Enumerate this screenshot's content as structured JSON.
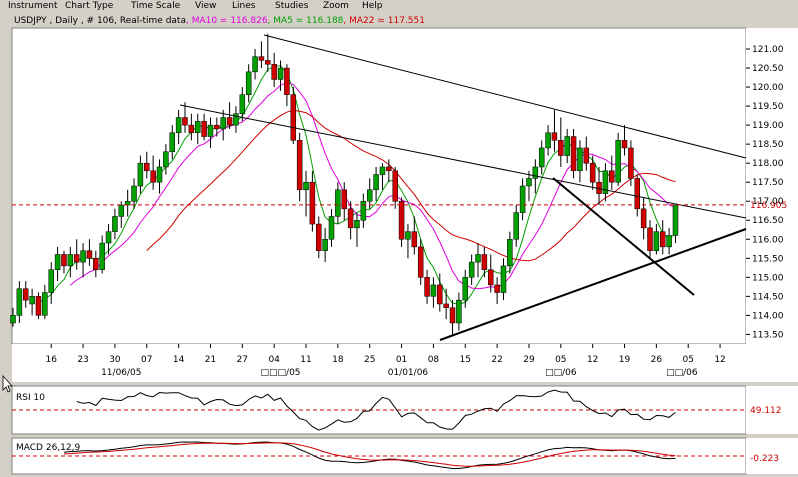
{
  "menu": [
    "Instrument",
    "Chart Type",
    "Time Scale",
    "View",
    "Lines",
    "Studies",
    "Zoom",
    "Help"
  ],
  "colors": {
    "candle_up": "#00a000",
    "candle_down": "#d00000",
    "ma10": "#e000e0",
    "ma5": "#00a000",
    "ma22": "#d00000",
    "ref_line": "#d00000",
    "trend": "#000000"
  },
  "chart_data": {
    "type": "candlestick",
    "header": {
      "symbol": "USDJPY , Daily , # 106, Real-time data",
      "ma10": ", MA10 = 116.826",
      "ma5": ", MA5 = 116.188",
      "ma22": ", MA22 = 117.551"
    },
    "ylim": [
      113.3,
      121.5
    ],
    "y_ticks": [
      113.5,
      114.0,
      114.5,
      115.0,
      115.5,
      116.0,
      116.5,
      117.0,
      117.5,
      118.0,
      118.5,
      119.0,
      119.5,
      120.0,
      120.5,
      121.0
    ],
    "y_tick_labels": [
      "113.50",
      "114.00",
      "114.50",
      "115.00",
      "115.50",
      "116.00",
      "116.50",
      "117.00",
      "117.50",
      "118.00",
      "118.50",
      "119.00",
      "119.50",
      "120.00",
      "120.50",
      "121.00"
    ],
    "last_price": {
      "value": 116.905,
      "label": "116.905"
    },
    "x_ticks": [
      {
        "i": 6,
        "label": "16"
      },
      {
        "i": 11,
        "label": "23"
      },
      {
        "i": 16,
        "label": "30"
      },
      {
        "i": 21,
        "label": "07"
      },
      {
        "i": 26,
        "label": "14"
      },
      {
        "i": 31,
        "label": "21"
      },
      {
        "i": 36,
        "label": "27"
      },
      {
        "i": 41,
        "label": "04"
      },
      {
        "i": 46,
        "label": "11"
      },
      {
        "i": 51,
        "label": "18"
      },
      {
        "i": 56,
        "label": "25"
      },
      {
        "i": 61,
        "label": "01"
      },
      {
        "i": 66,
        "label": "08"
      },
      {
        "i": 71,
        "label": "15"
      },
      {
        "i": 76,
        "label": "22"
      },
      {
        "i": 81,
        "label": "29"
      },
      {
        "i": 86,
        "label": "05"
      },
      {
        "i": 91,
        "label": "12"
      },
      {
        "i": 96,
        "label": "19"
      },
      {
        "i": 101,
        "label": "26"
      },
      {
        "i": 106,
        "label": "05"
      },
      {
        "i": 111,
        "label": "12"
      }
    ],
    "x_month_labels": [
      {
        "i": 17,
        "label": "11/06/05"
      },
      {
        "i": 42,
        "label": "□□□/05"
      },
      {
        "i": 62,
        "label": "01/01/06"
      },
      {
        "i": 86,
        "label": "□□/06"
      },
      {
        "i": 105,
        "label": "□□/06"
      }
    ],
    "candles": [
      [
        113.8,
        114.2,
        113.7,
        114.0
      ],
      [
        114.0,
        114.9,
        113.8,
        114.7
      ],
      [
        114.7,
        114.9,
        114.2,
        114.4
      ],
      [
        114.3,
        114.7,
        114.0,
        114.5
      ],
      [
        114.5,
        114.6,
        113.9,
        114.0
      ],
      [
        114.0,
        114.8,
        113.9,
        114.6
      ],
      [
        114.6,
        115.4,
        114.3,
        115.2
      ],
      [
        115.2,
        115.8,
        114.9,
        115.6
      ],
      [
        115.6,
        115.7,
        115.1,
        115.3
      ],
      [
        115.3,
        115.8,
        115.0,
        115.6
      ],
      [
        115.6,
        116.0,
        115.2,
        115.4
      ],
      [
        115.4,
        115.9,
        115.0,
        115.7
      ],
      [
        115.7,
        116.0,
        115.3,
        115.5
      ],
      [
        115.5,
        115.7,
        115.0,
        115.2
      ],
      [
        115.2,
        116.1,
        115.1,
        115.9
      ],
      [
        115.9,
        116.4,
        115.6,
        116.2
      ],
      [
        116.2,
        116.8,
        116.0,
        116.6
      ],
      [
        116.6,
        117.0,
        116.3,
        116.9
      ],
      [
        116.9,
        117.3,
        116.6,
        117.0
      ],
      [
        117.0,
        117.6,
        116.8,
        117.4
      ],
      [
        117.4,
        118.2,
        117.2,
        118.0
      ],
      [
        118.0,
        118.3,
        117.6,
        117.8
      ],
      [
        117.8,
        118.2,
        117.3,
        117.5
      ],
      [
        117.5,
        118.1,
        117.2,
        117.9
      ],
      [
        117.9,
        118.5,
        117.7,
        118.3
      ],
      [
        118.3,
        119.0,
        118.1,
        118.8
      ],
      [
        118.8,
        119.4,
        118.5,
        119.2
      ],
      [
        119.2,
        119.6,
        118.8,
        119.0
      ],
      [
        119.0,
        119.3,
        118.6,
        118.8
      ],
      [
        118.8,
        119.3,
        118.5,
        119.1
      ],
      [
        119.1,
        119.3,
        118.6,
        118.7
      ],
      [
        118.7,
        119.2,
        118.4,
        119.0
      ],
      [
        119.0,
        119.2,
        118.7,
        118.9
      ],
      [
        118.9,
        119.4,
        118.6,
        119.2
      ],
      [
        119.2,
        119.6,
        118.9,
        119.0
      ],
      [
        119.0,
        119.5,
        118.8,
        119.3
      ],
      [
        119.3,
        120.0,
        119.1,
        119.8
      ],
      [
        119.8,
        120.6,
        119.6,
        120.4
      ],
      [
        120.4,
        121.0,
        120.2,
        120.8
      ],
      [
        120.8,
        121.2,
        120.5,
        120.7
      ],
      [
        120.7,
        121.4,
        120.4,
        120.6
      ],
      [
        120.6,
        120.9,
        120.0,
        120.2
      ],
      [
        120.2,
        120.7,
        119.9,
        120.5
      ],
      [
        120.5,
        120.6,
        119.5,
        119.8
      ],
      [
        119.8,
        120.0,
        118.5,
        118.6
      ],
      [
        118.6,
        118.8,
        117.0,
        117.3
      ],
      [
        117.3,
        117.8,
        116.6,
        117.5
      ],
      [
        117.5,
        117.8,
        116.2,
        116.4
      ],
      [
        116.4,
        116.6,
        115.5,
        115.7
      ],
      [
        115.7,
        116.3,
        115.4,
        116.0
      ],
      [
        116.0,
        116.8,
        115.8,
        116.6
      ],
      [
        116.6,
        117.5,
        116.4,
        117.3
      ],
      [
        117.3,
        117.5,
        116.5,
        116.8
      ],
      [
        116.8,
        117.0,
        116.0,
        116.3
      ],
      [
        116.3,
        116.7,
        115.8,
        116.5
      ],
      [
        116.5,
        117.2,
        116.3,
        117.0
      ],
      [
        117.0,
        117.6,
        116.8,
        117.3
      ],
      [
        117.3,
        117.9,
        117.0,
        117.7
      ],
      [
        117.7,
        118.0,
        117.3,
        117.9
      ],
      [
        117.9,
        118.1,
        117.5,
        117.8
      ],
      [
        117.8,
        117.9,
        116.8,
        117.0
      ],
      [
        117.0,
        117.1,
        115.8,
        116.0
      ],
      [
        116.0,
        116.4,
        115.5,
        116.2
      ],
      [
        116.2,
        116.6,
        115.6,
        115.8
      ],
      [
        115.8,
        116.0,
        114.8,
        115.0
      ],
      [
        115.0,
        115.2,
        114.3,
        114.5
      ],
      [
        114.5,
        115.0,
        114.2,
        114.8
      ],
      [
        114.8,
        115.1,
        114.1,
        114.3
      ],
      [
        114.3,
        114.7,
        113.9,
        114.2
      ],
      [
        114.2,
        114.4,
        113.5,
        113.8
      ],
      [
        113.8,
        114.6,
        113.6,
        114.4
      ],
      [
        114.4,
        115.2,
        114.2,
        115.0
      ],
      [
        115.0,
        115.6,
        114.8,
        115.4
      ],
      [
        115.4,
        115.9,
        115.0,
        115.6
      ],
      [
        115.6,
        115.8,
        115.0,
        115.2
      ],
      [
        115.2,
        115.6,
        114.6,
        114.8
      ],
      [
        114.8,
        115.0,
        114.3,
        114.6
      ],
      [
        114.6,
        115.5,
        114.4,
        115.3
      ],
      [
        115.3,
        116.2,
        115.1,
        116.0
      ],
      [
        116.0,
        116.9,
        115.8,
        116.7
      ],
      [
        116.7,
        117.6,
        116.5,
        117.4
      ],
      [
        117.4,
        117.8,
        117.0,
        117.6
      ],
      [
        117.6,
        118.1,
        117.2,
        117.9
      ],
      [
        117.9,
        118.6,
        117.7,
        118.4
      ],
      [
        118.4,
        119.0,
        118.2,
        118.8
      ],
      [
        118.8,
        119.4,
        118.3,
        118.6
      ],
      [
        118.6,
        119.2,
        117.9,
        118.2
      ],
      [
        118.2,
        118.9,
        118.0,
        118.7
      ],
      [
        118.7,
        118.9,
        117.6,
        117.8
      ],
      [
        117.8,
        118.6,
        117.5,
        118.4
      ],
      [
        118.4,
        118.7,
        117.8,
        118.0
      ],
      [
        118.0,
        118.2,
        117.3,
        117.5
      ],
      [
        117.5,
        117.9,
        116.9,
        117.2
      ],
      [
        117.2,
        118.0,
        117.0,
        117.8
      ],
      [
        117.8,
        118.2,
        117.3,
        117.5
      ],
      [
        117.5,
        118.8,
        117.4,
        118.6
      ],
      [
        118.6,
        119.0,
        118.2,
        118.4
      ],
      [
        118.4,
        118.6,
        117.4,
        117.6
      ],
      [
        117.6,
        117.7,
        116.6,
        116.8
      ],
      [
        116.8,
        117.1,
        116.0,
        116.3
      ],
      [
        116.3,
        116.5,
        115.5,
        115.7
      ],
      [
        115.7,
        116.4,
        115.6,
        116.2
      ],
      [
        116.2,
        116.5,
        115.6,
        115.8
      ],
      [
        115.8,
        116.3,
        115.6,
        116.1
      ],
      [
        116.1,
        116.9,
        115.9,
        116.9
      ]
    ],
    "indicators": [
      {
        "label": "RSI 10",
        "value_label": "49.112"
      },
      {
        "label": "MACD 26,12,9",
        "value_label": "-0.223"
      }
    ]
  }
}
